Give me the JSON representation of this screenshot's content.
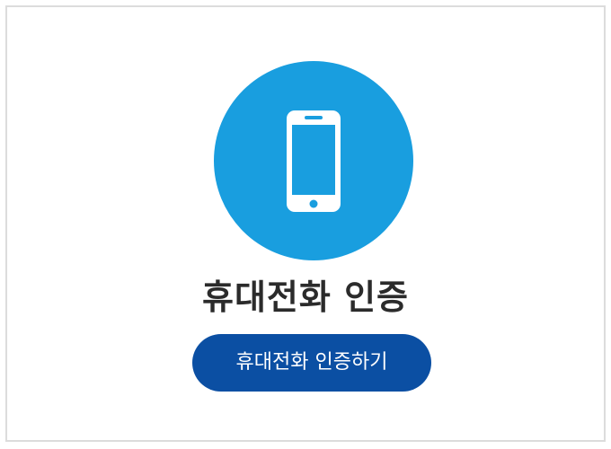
{
  "auth": {
    "icon": "smartphone-icon",
    "title": "휴대전화 인증",
    "button_label": "휴대전화 인증하기"
  },
  "colors": {
    "icon_circle": "#199edf",
    "button_bg": "#0b4fa3",
    "title_text": "#2b2b2b",
    "card_border": "#dcdcdc"
  }
}
